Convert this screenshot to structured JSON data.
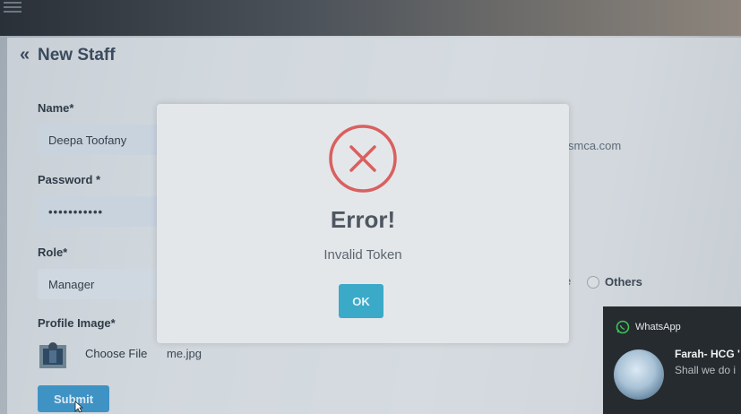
{
  "page": {
    "title": "New Staff"
  },
  "form": {
    "name_label": "Name*",
    "name_value": "Deepa Toofany",
    "email_value_fragment": "smca.com",
    "password_label": "Password *",
    "password_value": "•••••••••••",
    "role_label": "Role*",
    "role_value": "Manager",
    "gender_fragment": "e",
    "gender_option_others": "Others",
    "profile_image_label": "Profile Image*",
    "choose_file_label": "Choose File",
    "file_name": "me.jpg",
    "submit_label": "Submit"
  },
  "modal": {
    "title": "Error!",
    "message": "Invalid Token",
    "ok_label": "OK",
    "icon": "error-x-icon",
    "icon_color": "#d9605f"
  },
  "notification": {
    "app_name": "WhatsApp",
    "sender": "Farah- HCG '",
    "preview": "Shall we do i"
  },
  "colors": {
    "accent": "#3aaac8",
    "submit": "#3f93c4"
  }
}
